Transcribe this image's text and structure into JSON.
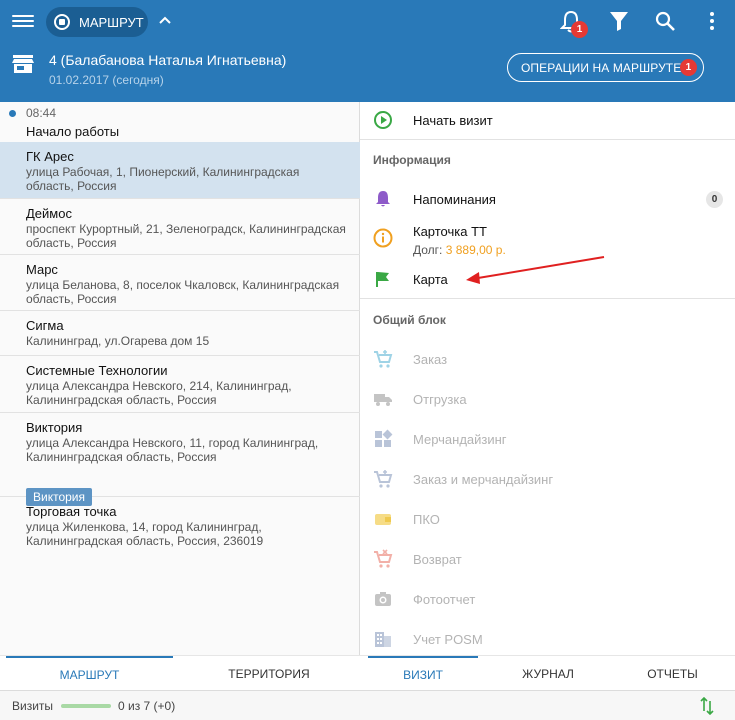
{
  "header": {
    "route_label": "МАРШРУТ",
    "notifications_count": "1",
    "store_name": "4 (Балабанова Наталья Игнатьевна)",
    "store_date": "01.02.2017 (сегодня)",
    "operations_label": "ОПЕРАЦИИ НА МАРШРУТЕ",
    "operations_count": "1"
  },
  "route": {
    "start": {
      "time": "08:44",
      "title": "Начало работы"
    },
    "outlets": [
      {
        "name": "ГК Арес",
        "address": "улица Рабочая, 1, Пионерский, Калининградская область, Россия",
        "selected": true
      },
      {
        "name": "Деймос",
        "address": "проспект Курортный, 21, Зеленоградск, Калининградская область, Россия"
      },
      {
        "name": "Марс",
        "address": "улица Беланова, 8, поселок Чкаловск, Калининградская область, Россия"
      },
      {
        "name": "Сигма",
        "address": "Калининград, ул.Огарева дом 15"
      },
      {
        "name": "Системные Технологии",
        "address": "улица Александра Невского, 214, Калининград, Калининградская область, Россия"
      },
      {
        "name": "Виктория",
        "address": "улица Александра Невского, 11, город Калининград, Калининградская область, Россия",
        "tag": "Виктория"
      },
      {
        "name": "Торговая точка",
        "address": "улица Жиленкова, 14, город Калининград, Калининградская область, Россия, 236019"
      }
    ]
  },
  "left_tabs": {
    "route": "МАРШРУТ",
    "territory": "ТЕРРИТОРИЯ"
  },
  "visit": {
    "start_visit": "Начать визит",
    "info_header": "Информация",
    "reminders": "Напоминания",
    "reminders_count": "0",
    "outlet_card": "Карточка ТТ",
    "debt_label": "Долг:",
    "debt_amount": "3 889,00 р.",
    "map": "Карта",
    "common_header": "Общий блок",
    "items": [
      "Заказ",
      "Отгрузка",
      "Мерчандайзинг",
      "Заказ и мерчандайзинг",
      "ПКО",
      "Возврат",
      "Фотоотчет",
      "Учет POSM"
    ]
  },
  "right_tabs": {
    "visit": "ВИЗИТ",
    "journal": "ЖУРНАЛ",
    "reports": "ОТЧЕТЫ"
  },
  "status": {
    "label": "Визиты",
    "count": "0 из 7 (+0)",
    "progress": 0
  },
  "colors": {
    "primary": "#2979b8",
    "badge": "#e53935",
    "selected_row": "#d3e2ef",
    "debt": "#f0a020",
    "annotation_arrow": "#e02020"
  }
}
